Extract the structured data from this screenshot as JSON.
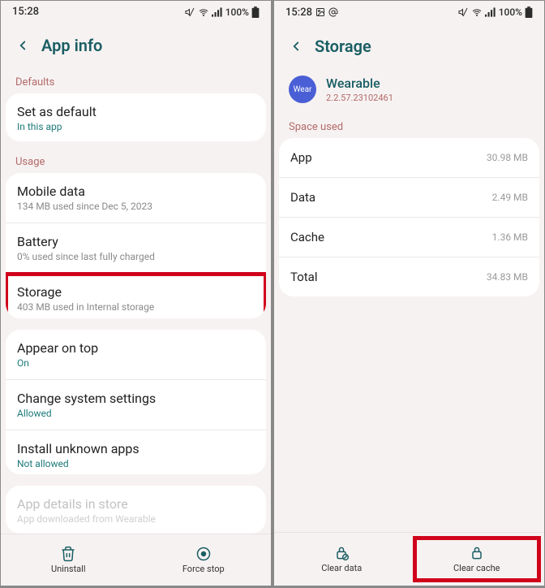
{
  "left": {
    "statusbar": {
      "time": "15:28",
      "battery": "100%"
    },
    "header": {
      "title": "App info"
    },
    "defaults": {
      "label": "Defaults",
      "setDefault": {
        "title": "Set as default",
        "sub": "In this app"
      }
    },
    "usage": {
      "label": "Usage",
      "mobileData": {
        "title": "Mobile data",
        "sub": "134 MB used since Dec 5, 2023"
      },
      "battery": {
        "title": "Battery",
        "sub": "0% used since last fully charged"
      },
      "storage": {
        "title": "Storage",
        "sub": "403 MB used in Internal storage"
      }
    },
    "other": {
      "appearOnTop": {
        "title": "Appear on top",
        "sub": "On"
      },
      "changeSystem": {
        "title": "Change system settings",
        "sub": "Allowed"
      },
      "installUnknown": {
        "title": "Install unknown apps",
        "sub": "Not allowed"
      }
    },
    "store": {
      "title": "App details in store",
      "sub": "App downloaded from Wearable"
    },
    "bottom": {
      "uninstall": "Uninstall",
      "forceStop": "Force stop"
    }
  },
  "right": {
    "statusbar": {
      "time": "15:28",
      "battery": "100%"
    },
    "header": {
      "title": "Storage"
    },
    "app": {
      "name": "Wearable",
      "version": "2.2.57.23102461",
      "iconText": "Wear"
    },
    "space": {
      "label": "Space used",
      "app": {
        "label": "App",
        "val": "30.98 MB"
      },
      "data": {
        "label": "Data",
        "val": "2.49 MB"
      },
      "cache": {
        "label": "Cache",
        "val": "1.36 MB"
      },
      "total": {
        "label": "Total",
        "val": "34.83 MB"
      }
    },
    "bottom": {
      "clearData": "Clear data",
      "clearCache": "Clear cache"
    }
  }
}
